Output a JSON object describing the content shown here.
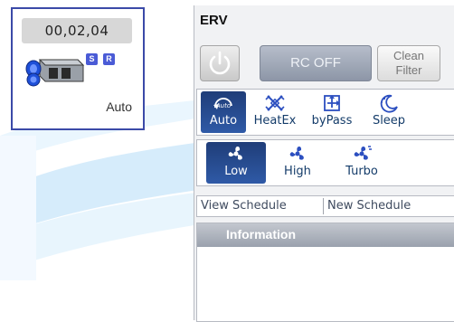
{
  "device_card": {
    "id_text": "00,02,04",
    "badges": [
      "S",
      "R"
    ],
    "mode_text": "Auto",
    "icon": "erv-unit-icon"
  },
  "erv_panel": {
    "title": "ERV",
    "power_icon": "power-icon",
    "rc_button_label": "RC OFF",
    "clean_filter_label_line1": "Clean",
    "clean_filter_label_line2": "Filter",
    "modes": [
      {
        "label": "Auto",
        "icon": "auto-mode-icon",
        "icon_text": "Auto",
        "selected": true
      },
      {
        "label": "HeatEx",
        "icon": "heat-exchange-icon",
        "selected": false
      },
      {
        "label": "byPass",
        "icon": "bypass-icon",
        "selected": false
      },
      {
        "label": "Sleep",
        "icon": "sleep-icon",
        "selected": false
      }
    ],
    "fan_speeds": [
      {
        "label": "Low",
        "icon": "fan-icon",
        "selected": true
      },
      {
        "label": "High",
        "icon": "fan-icon",
        "selected": false
      },
      {
        "label": "Turbo",
        "icon": "fan-icon",
        "selected": false
      }
    ],
    "schedule_tabs": {
      "view": "View Schedule",
      "new": "New Schedule"
    },
    "information_title": "Information"
  },
  "colors": {
    "selected_bg": "#2a4f95",
    "icon_blue": "#2c4fc0",
    "card_border": "#3b4aa8",
    "badge_bg": "#4a5bd6"
  }
}
